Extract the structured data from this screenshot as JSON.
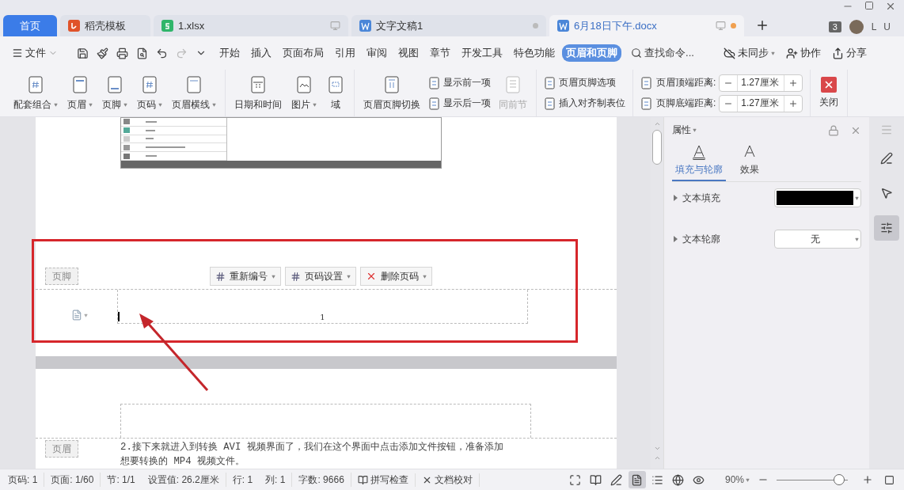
{
  "tabs": [
    {
      "label": "首页",
      "kind": "home",
      "selected": false,
      "device": false,
      "unsaved": false
    },
    {
      "label": "稻壳模板",
      "kind": "docer",
      "selected": false,
      "device": false,
      "unsaved": false
    },
    {
      "label": "1.xlsx",
      "kind": "sheet",
      "selected": false,
      "device": true,
      "unsaved": false
    },
    {
      "label": "文字文稿1",
      "kind": "writer",
      "selected": false,
      "device": false,
      "unsaved": true
    },
    {
      "label": "6月18日下午.docx",
      "kind": "writer",
      "selected": true,
      "device": true,
      "unsaved": true
    }
  ],
  "tab_count": "3",
  "user": "L U",
  "menu": {
    "file": "文件",
    "tabs": [
      {
        "label": "开始",
        "selected": false
      },
      {
        "label": "插入",
        "selected": false
      },
      {
        "label": "页面布局",
        "selected": false
      },
      {
        "label": "引用",
        "selected": false
      },
      {
        "label": "审阅",
        "selected": false
      },
      {
        "label": "视图",
        "selected": false
      },
      {
        "label": "章节",
        "selected": false
      },
      {
        "label": "开发工具",
        "selected": false
      },
      {
        "label": "特色功能",
        "selected": false
      },
      {
        "label": "页眉和页脚",
        "selected": true
      }
    ],
    "search": {
      "placeholder": "查找命令..."
    },
    "actions": [
      {
        "label": "未同步",
        "dropdown": true
      },
      {
        "label": "协作",
        "dropdown": false
      },
      {
        "label": "分享",
        "dropdown": false
      }
    ]
  },
  "ribbon": {
    "groups": [
      {
        "items": [
          {
            "kind": "large",
            "label": "配套组合",
            "dropdown": true
          },
          {
            "kind": "large",
            "label": "页眉",
            "dropdown": true
          },
          {
            "kind": "large",
            "label": "页脚",
            "dropdown": true
          },
          {
            "kind": "large",
            "label": "页码",
            "dropdown": true
          },
          {
            "kind": "large",
            "label": "页眉横线",
            "dropdown": true
          }
        ]
      },
      {
        "items": [
          {
            "kind": "large",
            "label": "日期和时间",
            "dropdown": false
          },
          {
            "kind": "large",
            "label": "图片",
            "dropdown": true
          },
          {
            "kind": "large",
            "label": "域",
            "dropdown": false
          }
        ]
      },
      {
        "items": [
          {
            "kind": "large",
            "label": "页眉页脚切换",
            "dropdown": false
          },
          {
            "kind": "stack",
            "items": [
              {
                "label": "显示前一项"
              },
              {
                "label": "显示后一项"
              }
            ]
          },
          {
            "kind": "large",
            "label": "同前节",
            "dropdown": false,
            "disabled": true
          }
        ]
      },
      {
        "items": [
          {
            "kind": "stack",
            "items": [
              {
                "label": "页眉页脚选项"
              },
              {
                "label": "插入对齐制表位"
              }
            ]
          }
        ]
      },
      {
        "items": [
          {
            "kind": "spin",
            "fields": [
              {
                "label": "页眉顶端距离:",
                "value": "1.27厘米"
              },
              {
                "label": "页脚底端距离:",
                "value": "1.27厘米"
              }
            ]
          }
        ]
      },
      {
        "items": [
          {
            "kind": "close",
            "label": "关闭"
          }
        ]
      }
    ]
  },
  "document": {
    "footer_label": "页脚",
    "footer_buttons": [
      {
        "label": "重新编号",
        "dropdown": true
      },
      {
        "label": "页码设置",
        "dropdown": true
      },
      {
        "label": "删除页码",
        "dropdown": true
      }
    ],
    "page_number": "1",
    "header_label": "页眉",
    "body_lines": [
      "2.接下来就进入到转换 AVI 视频界面了，我们在这个界面中点击添加文件按钮，准备添加",
      "想要转换的 MP4 视频文件。"
    ]
  },
  "panel": {
    "title": "属性",
    "tabs": [
      {
        "label": "填充与轮廓",
        "selected": true
      },
      {
        "label": "效果",
        "selected": false
      }
    ],
    "rows": [
      {
        "label": "文本填充",
        "kind": "color",
        "color": "#000000"
      },
      {
        "label": "文本轮廓",
        "kind": "select",
        "value": "无"
      }
    ]
  },
  "side_tools": [
    {
      "selected": false
    },
    {
      "selected": false
    },
    {
      "selected": true
    }
  ],
  "status": {
    "items": [
      {
        "text": "页码: 1",
        "divider": true
      },
      {
        "text": "页面: 1/60",
        "divider": true
      },
      {
        "text": "节: 1/1",
        "divider": false
      },
      {
        "text": "设置值: 26.2厘米",
        "divider": true
      },
      {
        "text": "行: 1",
        "divider": false
      },
      {
        "text": "列: 1",
        "divider": true
      },
      {
        "text": "字数: 9666",
        "divider": true
      }
    ],
    "checks": [
      {
        "label": "拼写检查"
      },
      {
        "label": "文档校对"
      }
    ],
    "views": [
      {
        "selected": false
      },
      {
        "selected": false
      },
      {
        "selected": false
      },
      {
        "selected": true
      },
      {
        "selected": false
      },
      {
        "selected": false
      },
      {
        "selected": false
      }
    ],
    "zoom": "90%",
    "zoom_slider": {
      "level": 0.88
    }
  }
}
